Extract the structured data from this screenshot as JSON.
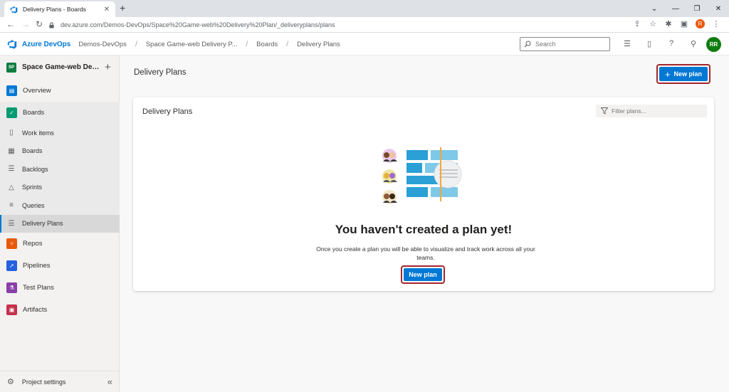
{
  "browser": {
    "tab_title": "Delivery Plans - Boards",
    "url": "dev.azure.com/Demos-DevOps/Space%20Game-web%20Delivery%20Plan/_deliveryplans/plans",
    "profile_initial": "R"
  },
  "header": {
    "brand": "Azure DevOps",
    "breadcrumbs": [
      "Demos-DevOps",
      "Space Game-web Delivery P...",
      "Boards",
      "Delivery Plans"
    ],
    "search_placeholder": "Search",
    "user_initials": "RR",
    "avatar_color": "#107c10"
  },
  "sidebar": {
    "project_initials": "SP",
    "project_name": "Space Game-web Delivery Plan",
    "items": [
      {
        "label": "Overview",
        "color": "#0078d4"
      },
      {
        "label": "Boards",
        "color": "#009b70"
      },
      {
        "label": "Repos",
        "color": "#e8590c"
      },
      {
        "label": "Pipelines",
        "color": "#2560e0"
      },
      {
        "label": "Test Plans",
        "color": "#8a3fa8"
      },
      {
        "label": "Artifacts",
        "color": "#c4314b"
      }
    ],
    "boards_sub": [
      "Work items",
      "Boards",
      "Backlogs",
      "Sprints",
      "Queries",
      "Delivery Plans"
    ],
    "settings_label": "Project settings"
  },
  "main": {
    "page_title": "Delivery Plans",
    "new_plan_label": "New plan",
    "card_title": "Delivery Plans",
    "filter_placeholder": "Filter plans...",
    "empty_title": "You haven't created a plan yet!",
    "empty_description": "Once you create a plan you will be able to visualize and track work across all your teams.",
    "empty_button_label": "New plan"
  },
  "colors": {
    "accent": "#0078d4",
    "highlight_border": "#a4262c"
  }
}
